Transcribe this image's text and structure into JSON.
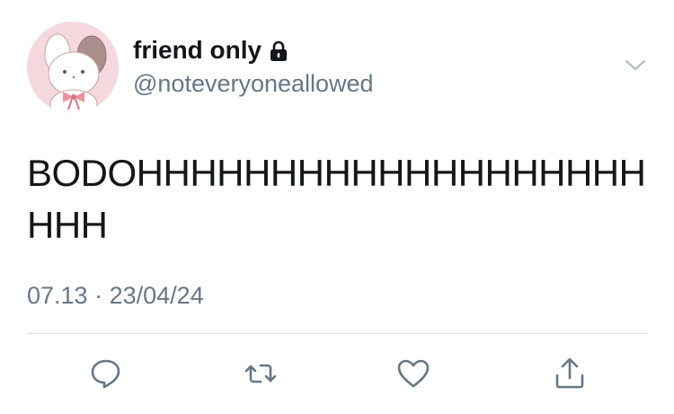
{
  "tweet": {
    "display_name": "friend only",
    "handle": "@noteveryoneallowed",
    "protected_icon": "lock-icon",
    "text": "BODOHHHHHHHHHHHHHHHHHHHHHH",
    "time": "07.13",
    "separator": "·",
    "date": "23/04/24"
  },
  "actions": {
    "reply_icon": "speech-bubble-icon",
    "retweet_icon": "retweet-icon",
    "like_icon": "heart-icon",
    "share_icon": "share-icon"
  },
  "colors": {
    "text_primary": "#14171a",
    "text_secondary": "#657786",
    "icon": "#657786",
    "divider": "#d6dde3",
    "avatar_bg": "#f6d9df"
  }
}
